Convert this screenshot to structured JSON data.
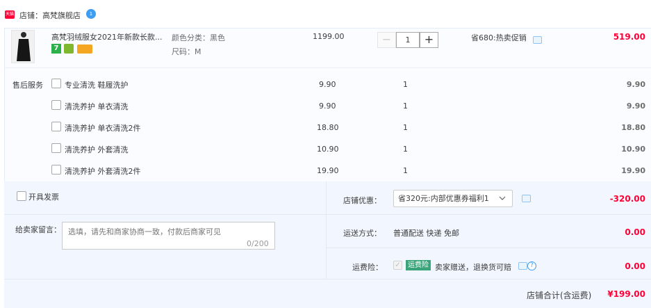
{
  "shop": {
    "label": "店铺：高梵旗舰店",
    "logo_text": "天猫",
    "chat_badge": "1"
  },
  "item": {
    "title": "高梵羽绒服女2021年新款长款...",
    "badge_text": "7",
    "sku_color": "颜色分类：黑色",
    "sku_size": "尺码：M",
    "price": "1199.00",
    "quantity": "1",
    "promo": "省680:热卖促销",
    "subtotal": "519.00"
  },
  "services": {
    "label": "售后服务",
    "items": [
      {
        "name": "专业清洗 鞋履洗护",
        "price": "9.90",
        "qty": "1",
        "total": "9.90"
      },
      {
        "name": "清洗养护 单衣清洗",
        "price": "9.90",
        "qty": "1",
        "total": "9.90"
      },
      {
        "name": "清洗养护 单衣清洗2件",
        "price": "18.80",
        "qty": "1",
        "total": "18.80"
      },
      {
        "name": "清洗养护 外套清洗",
        "price": "10.90",
        "qty": "1",
        "total": "10.90"
      },
      {
        "name": "清洗养护 外套清洗2件",
        "price": "19.90",
        "qty": "1",
        "total": "19.90"
      }
    ]
  },
  "invoice": {
    "label": "开具发票"
  },
  "message": {
    "label": "给卖家留言：",
    "placeholder": "选填，请先和商家协商一致，付款后商家可见",
    "count": "0/200"
  },
  "coupon": {
    "label": "店铺优惠：",
    "selected": "省320元:内部优惠券福利1",
    "value": "-320.00"
  },
  "shipping": {
    "label": "运送方式：",
    "value": "普通配送 快递 免邮",
    "fee": "0.00"
  },
  "insurance": {
    "label": "运费险：",
    "badge": "运费险",
    "text": "卖家赠送，退换货可赔",
    "fee": "0.00"
  },
  "total": {
    "label": "店铺合计(含运费)",
    "value": "¥199.00"
  },
  "colors": {
    "accent": "#ff0036",
    "panel": "#f2f7ff",
    "insurance_badge": "#3aa37a"
  }
}
